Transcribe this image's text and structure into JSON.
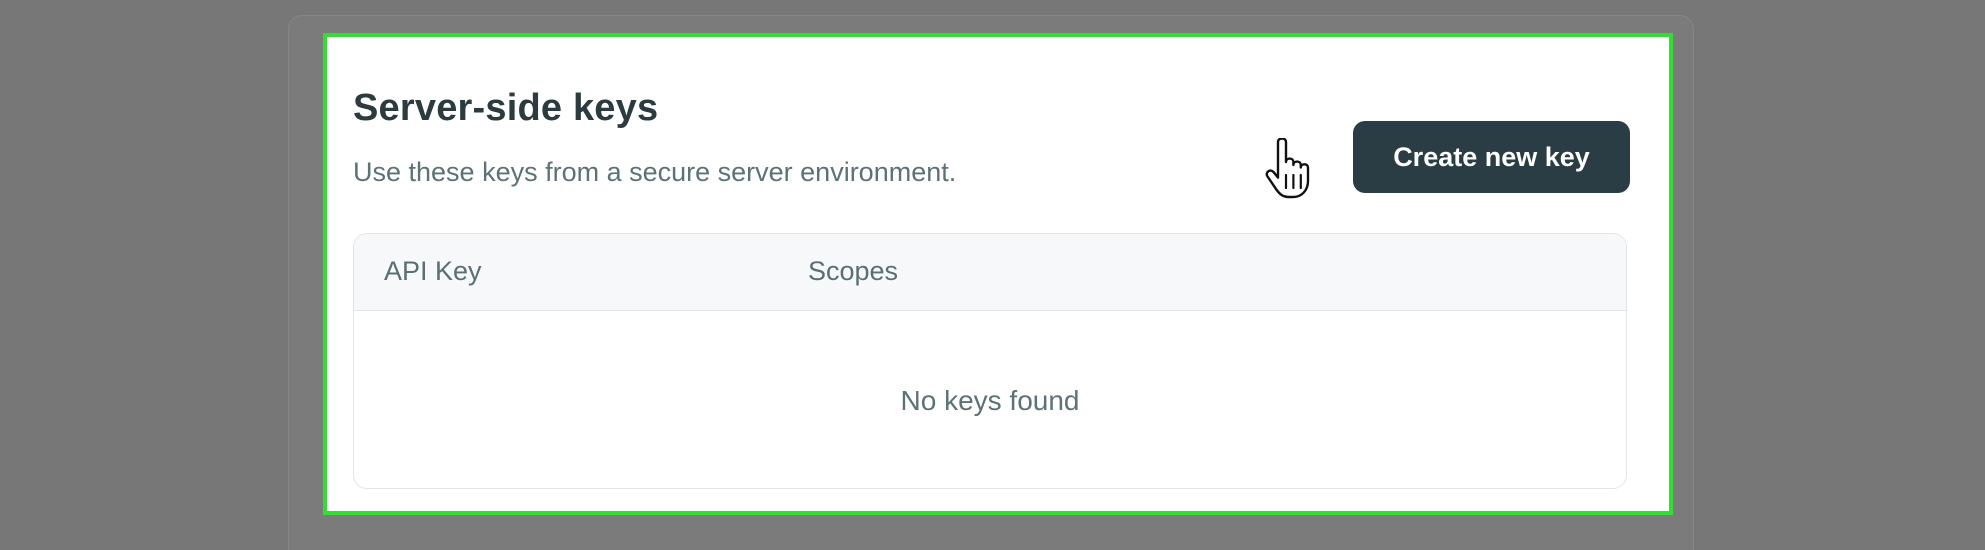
{
  "section": {
    "title": "Server-side keys",
    "description": "Use these keys from a secure server environment."
  },
  "actions": {
    "create_label": "Create new key"
  },
  "table": {
    "columns": [
      "API Key",
      "Scopes"
    ],
    "empty_message": "No keys found"
  },
  "colors": {
    "highlight": "#33dd33",
    "button": "#2a3d44",
    "backdrop": "#777777"
  },
  "icons": {
    "cursor": "hand-pointer-icon"
  }
}
